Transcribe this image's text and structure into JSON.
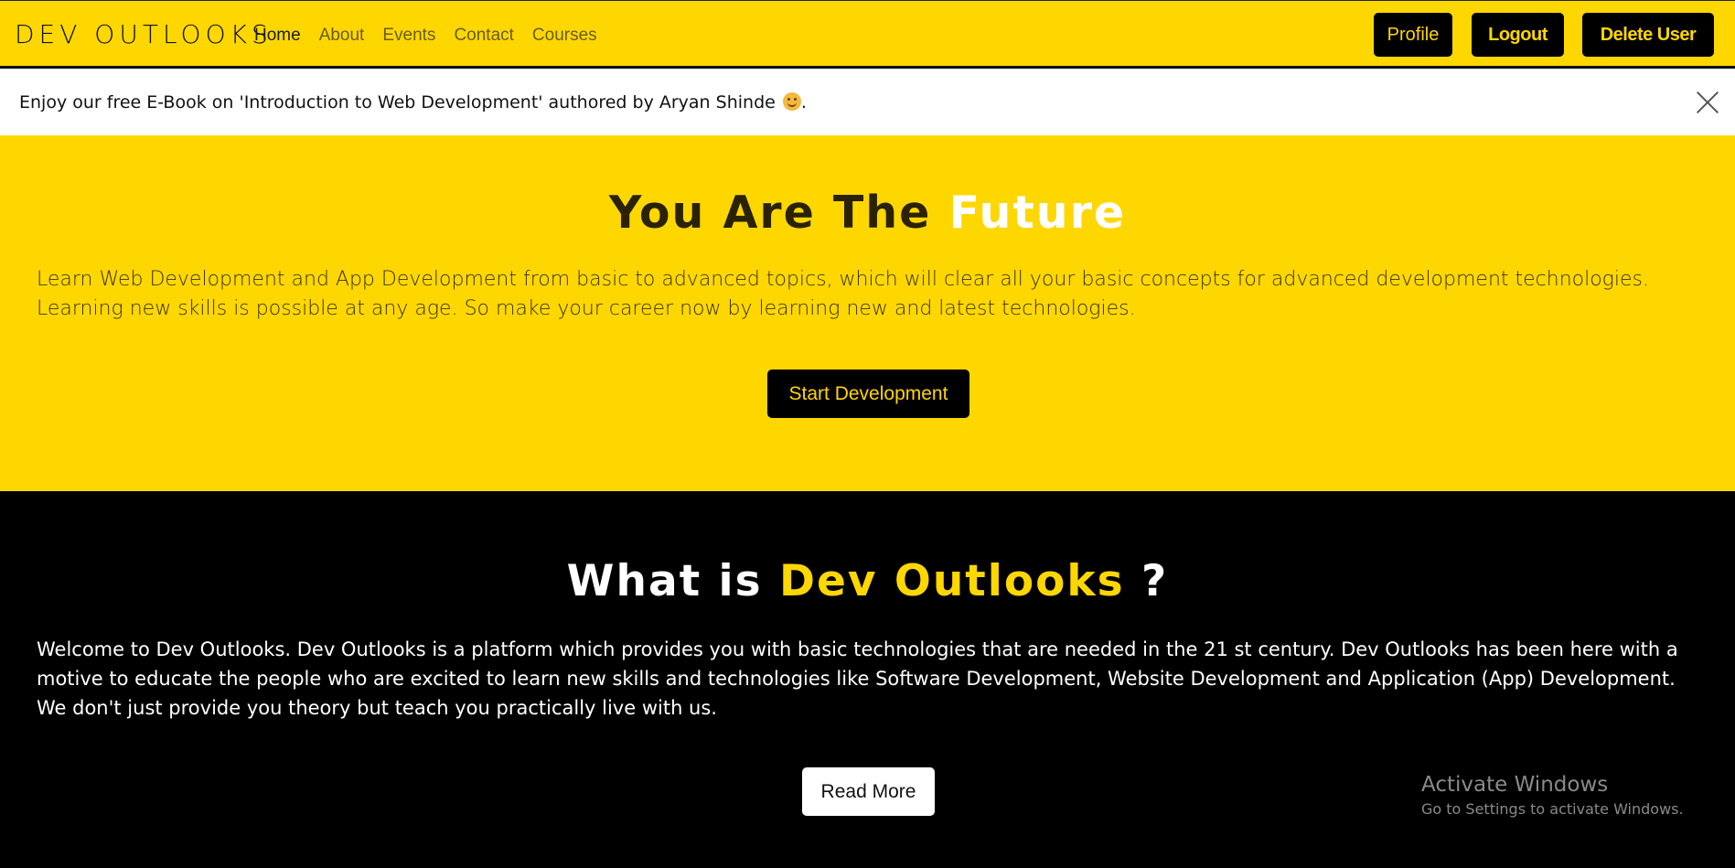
{
  "navbar": {
    "brand": "DEV OUTLOOKS",
    "links": [
      {
        "label": "Home",
        "active": true
      },
      {
        "label": "About",
        "active": false
      },
      {
        "label": "Events",
        "active": false
      },
      {
        "label": "Contact",
        "active": false
      },
      {
        "label": "Courses",
        "active": false
      }
    ],
    "buttons": {
      "profile": "Profile",
      "logout": "Logout",
      "delete_user": "Delete User"
    }
  },
  "alert": {
    "text": "Enjoy our free E-Book on 'Introduction to Web Development' authored by Aryan Shinde",
    "emoji_icon": "smiling-face-emoji",
    "suffix": "."
  },
  "hero": {
    "title_prefix": "You Are The ",
    "title_highlight": "Future",
    "paragraph": "Learn Web Development and App Development from basic to advanced topics, which will clear all your basic concepts for advanced development technologies. Learning new skills is possible at any age. So make your career now by learning new and latest technologies.",
    "button": "Start Development"
  },
  "about": {
    "title_prefix": "What is ",
    "title_highlight": "Dev Outlooks",
    "title_suffix": " ?",
    "paragraph": "Welcome to Dev Outlooks. Dev Outlooks is a platform which provides you with basic technologies that are needed in the 21 st century. Dev Outlooks has been here with a motive to educate the people who are excited to learn new skills and technologies like Software Development, Website Development and Application (App) Development. We don't just provide you theory but teach you practically live with us.",
    "button": "Read More"
  },
  "watermark": {
    "title": "Activate Windows",
    "subtitle": "Go to Settings to activate Windows."
  },
  "colors": {
    "brand_yellow": "#ffd700",
    "black": "#000000",
    "white": "#ffffff"
  }
}
